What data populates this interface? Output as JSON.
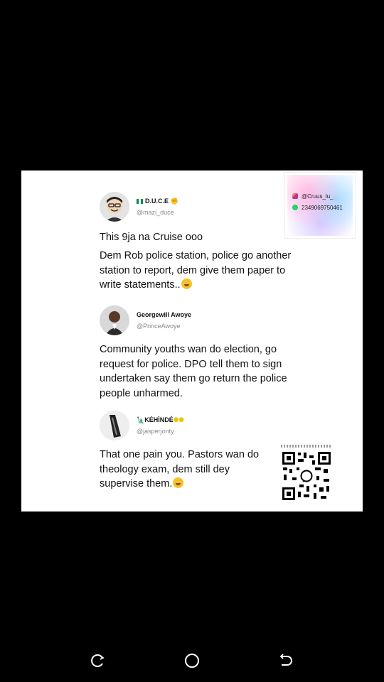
{
  "post": {
    "tweets": [
      {
        "name": "D.U.C.E",
        "handle": "@mazi_duce",
        "headline": "This 9ja na Cruise ooo",
        "text": "Dem Rob police station, police go another station to report, dem give them paper to write statements.."
      },
      {
        "name": "Georgewill Awoye",
        "handle": "@PrinceAwoye",
        "text": "Community youths wan do election, go request for police. DPO tell them to sign undertaken say them go return the police people unharmed."
      },
      {
        "name": "KÉHÌNDÉ",
        "handle": "@jasperjonty",
        "text": "That one pain you. Pastors wan do theology exam, dem still dey supervise them."
      }
    ],
    "watermark": {
      "instagram": "@Cruus_lu_",
      "whatsapp": "2349069750461"
    }
  },
  "icons": {
    "flag": "nigeria-flag-icon",
    "instagram": "instagram-icon",
    "whatsapp": "whatsapp-icon",
    "qr": "qr-code-icon",
    "recent_apps": "recent-apps-icon",
    "home": "home-icon",
    "back": "back-icon"
  }
}
